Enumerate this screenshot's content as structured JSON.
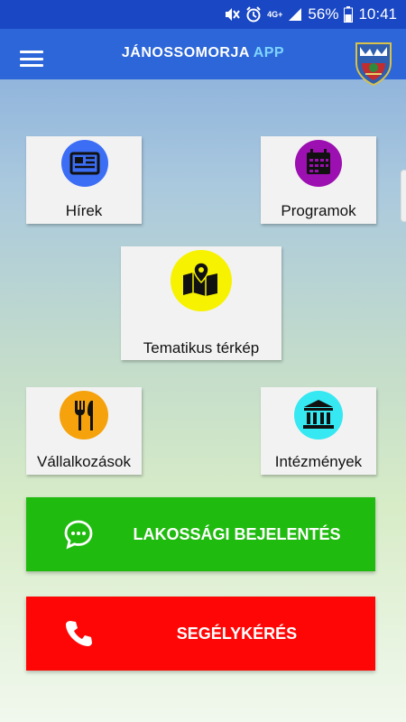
{
  "status": {
    "network": "4G+",
    "battery": "56%",
    "time": "10:41",
    "icons": [
      "mute-icon",
      "alarm-icon",
      "signal-icon",
      "battery-icon"
    ]
  },
  "header": {
    "title_main": "JÁNOSSOMORJA",
    "title_accent": "APP",
    "accent_color": "#7ed4ff",
    "bar_color": "#2c66d8"
  },
  "tiles": [
    {
      "label": "Hírek",
      "icon": "newspaper-icon",
      "color": "#3c6ef5"
    },
    {
      "label": "Programok",
      "icon": "calendar-icon",
      "color": "#9c0fb0"
    },
    {
      "label": "Tematikus térkép",
      "icon": "map-icon",
      "color": "#f7f200"
    },
    {
      "label": "Vállalkozások",
      "icon": "cutlery-icon",
      "color": "#f5a20c"
    },
    {
      "label": "Intézmények",
      "icon": "institution-icon",
      "color": "#36e8f2"
    }
  ],
  "actions": [
    {
      "label": "LAKOSSÁGI BEJELENTÉS",
      "icon": "chat-icon",
      "color": "#1fbb0f"
    },
    {
      "label": "SEGÉLYKÉRÉS",
      "icon": "phone-icon",
      "color": "#ff0606"
    }
  ]
}
